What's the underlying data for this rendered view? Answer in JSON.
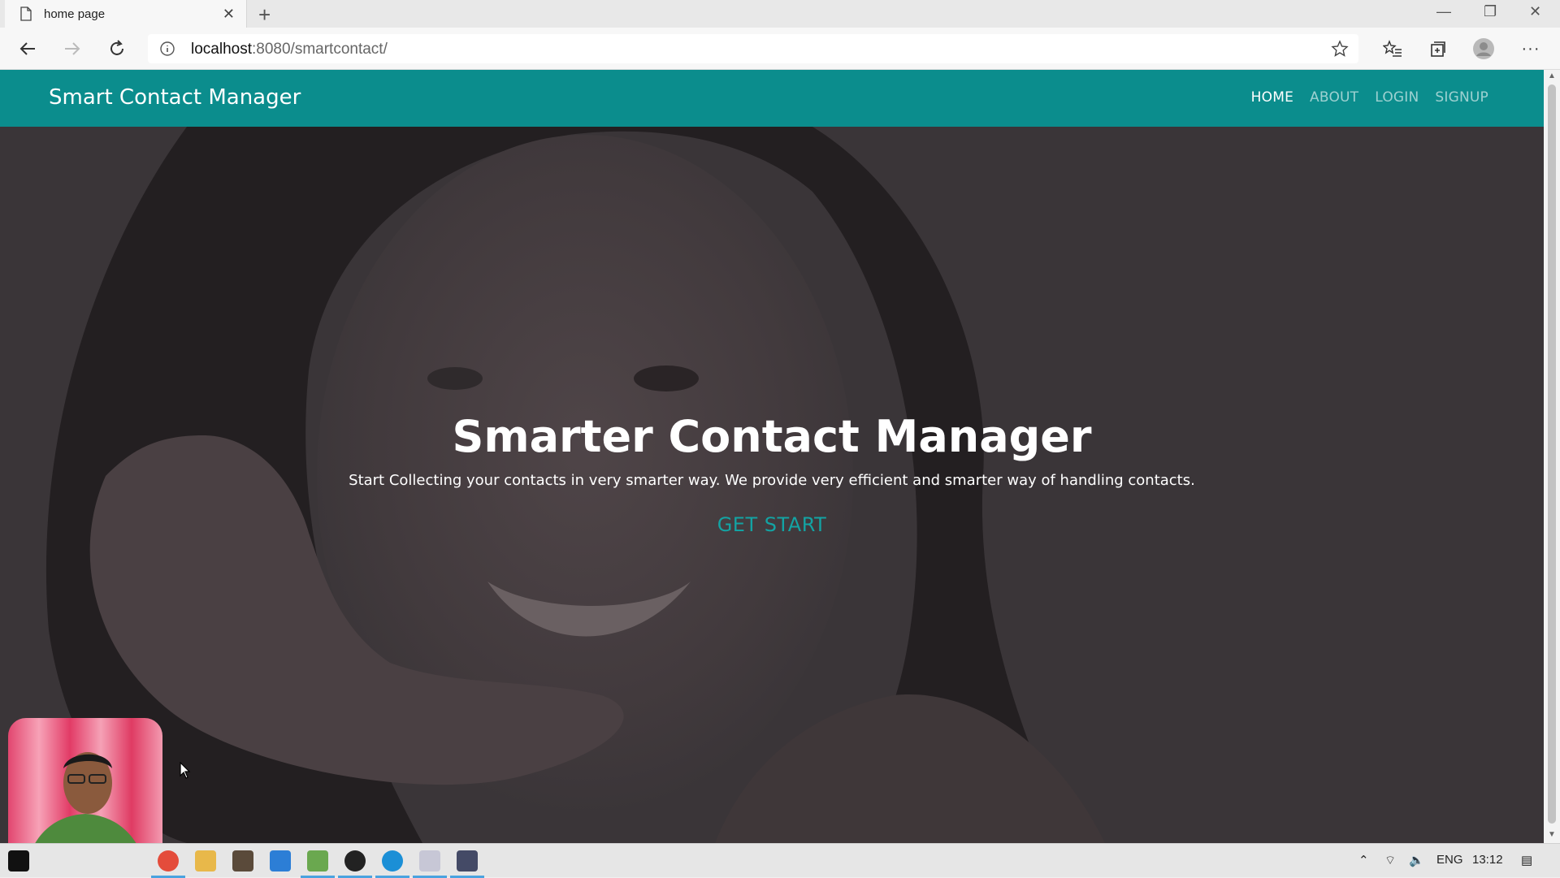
{
  "browser": {
    "tab_title": "home page",
    "url_host": "localhost",
    "url_path": ":8080/smartcontact/"
  },
  "nav": {
    "brand": "Smart Contact Manager",
    "links": [
      "HOME",
      "ABOUT",
      "LOGIN",
      "SIGNUP"
    ],
    "active": "HOME"
  },
  "hero": {
    "title": "Smarter Contact Manager",
    "subtitle": "Start Collecting your contacts in very smarter way. We provide very efficient and smarter way of handling contacts.",
    "button": "GET START"
  },
  "taskbar": {
    "language": "ENG",
    "time": "13:12"
  },
  "colors": {
    "navbar": "#0b8d8d",
    "accent": "#13a3a3",
    "hero_overlay": "#3a3538"
  }
}
